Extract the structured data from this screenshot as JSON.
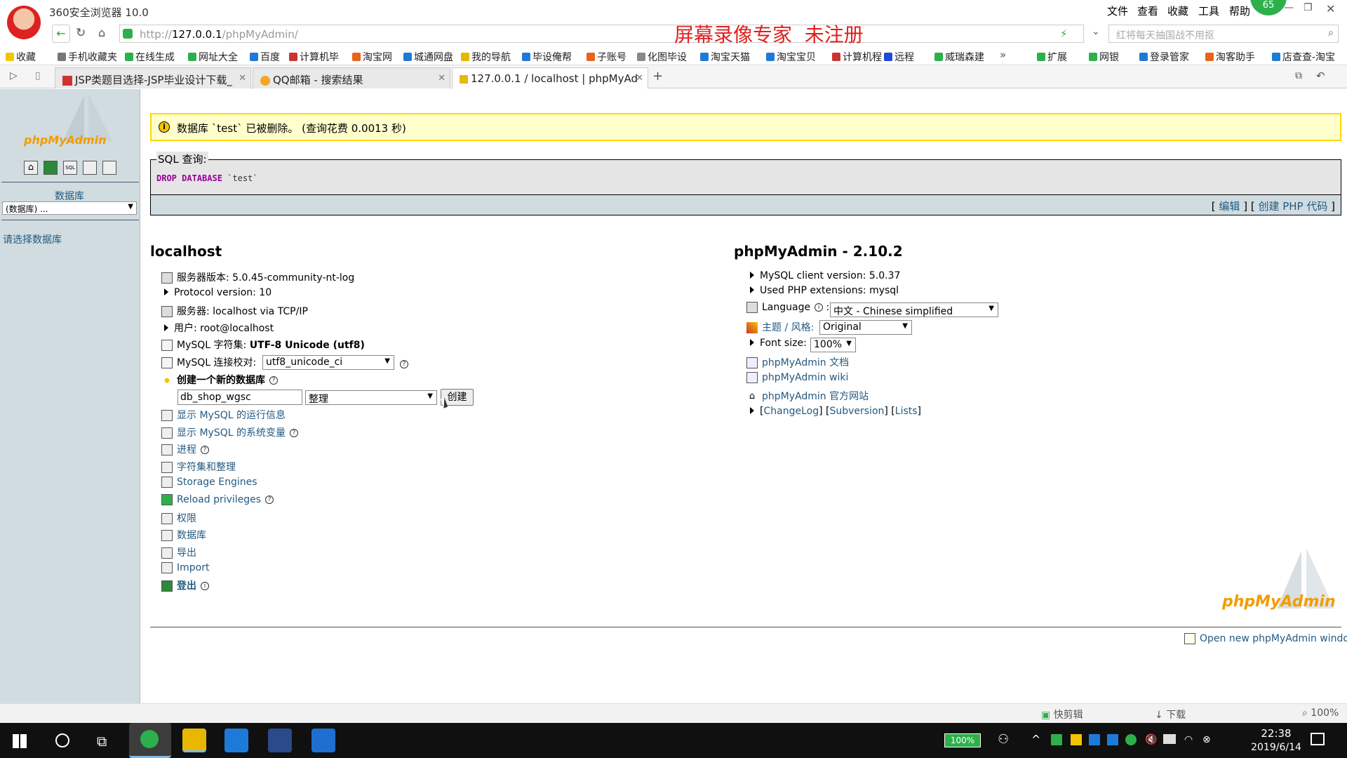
{
  "browser": {
    "title": "360安全浏览器 10.0",
    "watermark": "屏幕录像专家  未注册",
    "menu": [
      "文件",
      "查看",
      "收藏",
      "工具",
      "帮助"
    ],
    "badge": "65",
    "url_prefix": "http://",
    "url_host": "127.0.0.1",
    "url_path": "/phpMyAdmin/",
    "search_placeholder": "红将每天抽国战不用抠",
    "bookmarks": [
      "收藏",
      "手机收藏夹",
      "在线生成",
      "网址大全",
      "百度",
      "计算机毕",
      "淘宝网",
      "城通网盘",
      "我的导航",
      "毕设俺帮",
      "子账号",
      "化图毕设",
      "淘宝天猫",
      "淘宝宝贝",
      "计算机程",
      "远程",
      "威瑞森建"
    ],
    "bookmarks_right": [
      "扩展",
      "网银",
      "登录管家",
      "淘客助手",
      "店查查-淘宝"
    ],
    "tabs": [
      {
        "label": "JSP类题目选择-JSP毕业设计下载_",
        "active": false
      },
      {
        "label": "QQ邮箱 - 搜索结果",
        "active": false
      },
      {
        "label": "127.0.0.1 / localhost | phpMyAd",
        "active": true
      }
    ]
  },
  "sidebar": {
    "logo_text": "phpMyAdmin",
    "db_label": "数据库",
    "db_select": "(数据库) ...",
    "hint": "请选择数据库"
  },
  "message": {
    "text": "数据库 `test` 已被删除。 (查询花费 0.0013 秒)"
  },
  "sql": {
    "legend": "SQL 查询:",
    "keyword": "DROP DATABASE",
    "arg": "`test`",
    "edit": "编辑",
    "create_php": "创建 PHP 代码"
  },
  "server": {
    "heading": "localhost",
    "version": "服务器版本: 5.0.45-community-nt-log",
    "protocol": "Protocol version: 10",
    "host": "服务器: localhost via TCP/IP",
    "user": "用户: root@localhost",
    "charset_label": "MySQL 字符集: ",
    "charset_value": "UTF-8 Unicode (utf8)",
    "collation_label": "MySQL 连接校对:",
    "collation_value": "utf8_unicode_ci",
    "create_db_label": "创建一个新的数据库",
    "new_db_value": "db_shop_wgsc",
    "new_db_collation": "整理",
    "create_button": "创建",
    "links": [
      "显示 MySQL 的运行信息",
      "显示 MySQL 的系统变量",
      "进程",
      "字符集和整理",
      "Storage Engines",
      "Reload privileges",
      "权限",
      "数据库",
      "导出",
      "Import",
      "登出"
    ]
  },
  "pma": {
    "heading": "phpMyAdmin - 2.10.2",
    "client": "MySQL client version: 5.0.37",
    "php_ext": "Used PHP extensions: mysql",
    "language_label": "Language",
    "language_value": "中文 - Chinese simplified",
    "theme_label": "主题 / 风格:",
    "theme_value": "Original",
    "fontsize_label": "Font size:",
    "fontsize_value": "100%",
    "doc": "phpMyAdmin 文档",
    "wiki": "phpMyAdmin wiki",
    "site": "phpMyAdmin 官方网站",
    "changelog": "ChangeLog",
    "subversion": "Subversion",
    "lists": "Lists",
    "open_window": "Open new phpMyAdmin window",
    "logo_text": "phpMyAdmin"
  },
  "status": {
    "items": [
      "快剪辑",
      "下载",
      "100%"
    ]
  },
  "taskbar": {
    "battery": "100%",
    "time": "22:38",
    "date": "2019/6/14"
  }
}
